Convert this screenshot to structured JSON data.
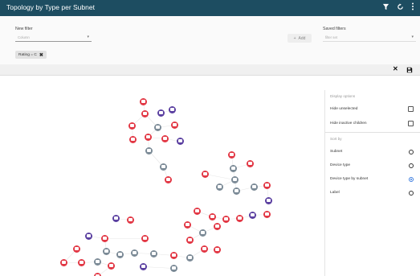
{
  "titlebar": {
    "title": "Topology by Type per Subnet",
    "filter_icon": "filter-icon",
    "refresh_icon": "refresh-icon",
    "menu_icon": "more-vertical-icon"
  },
  "filters": {
    "new_filter_label": "New filter",
    "column_placeholder": "Column",
    "add_label": "Add",
    "saved_filters_label": "Saved filters",
    "filter_set_placeholder": "filter set",
    "active_chip": "Rating = C"
  },
  "toolbar": {
    "close_icon": "close-icon",
    "save_icon": "save-icon"
  },
  "display_options": {
    "title": "Display options",
    "hide_unselected": "Hide unselected",
    "hide_inactive_children": "Hide inactive children",
    "sort_by_title": "Sort by",
    "sort_options": [
      "Subnet",
      "Device type",
      "Device type by subnet",
      "Label"
    ],
    "selected_sort": "Device type by subnet"
  },
  "colors": {
    "header": "#1d4d61",
    "red": "#e23744",
    "purple": "#5a3fa0",
    "grey": "#7b8a96",
    "accent": "#3f7fe0"
  }
}
